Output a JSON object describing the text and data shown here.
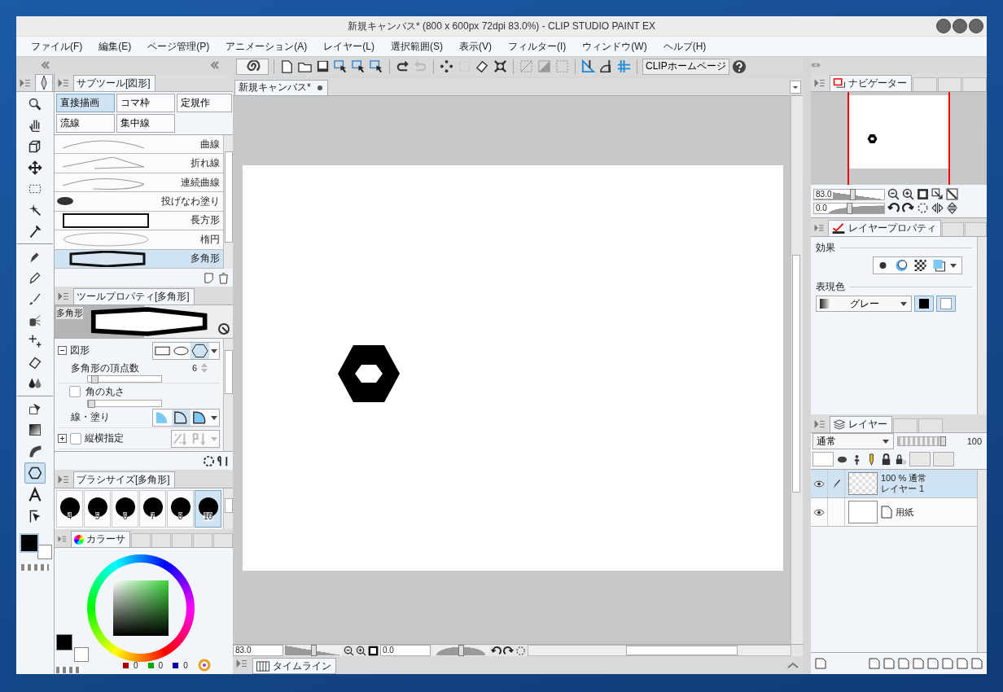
{
  "window": {
    "title": "新規キャンバス* (800 x 600px 72dpi 83.0%)  - CLIP STUDIO PAINT EX"
  },
  "menu": [
    {
      "label": "ファイル(F)"
    },
    {
      "label": "編集(E)"
    },
    {
      "label": "ページ管理(P)"
    },
    {
      "label": "アニメーション(A)"
    },
    {
      "label": "レイヤー(L)"
    },
    {
      "label": "選択範囲(S)"
    },
    {
      "label": "表示(V)"
    },
    {
      "label": "フィルター(I)"
    },
    {
      "label": "ウィンドウ(W)"
    },
    {
      "label": "ヘルプ(H)"
    }
  ],
  "toolbar": {
    "homepage": "CLIPホームページ"
  },
  "tools": [
    {
      "selected": false
    },
    {
      "selected": false
    },
    {
      "selected": false
    },
    {
      "selected": false
    },
    {
      "selected": false
    },
    {
      "selected": false
    },
    {
      "selected": false
    },
    {
      "selected": false
    },
    {
      "selected": false
    },
    {
      "selected": false
    },
    {
      "selected": false
    },
    {
      "selected": false
    },
    {
      "selected": false
    },
    {
      "selected": false
    },
    {
      "selected": false
    },
    {
      "selected": false
    },
    {
      "selected": false
    },
    {
      "selected": true
    },
    {
      "selected": false
    },
    {
      "selected": false
    }
  ],
  "subtool": {
    "tab": "サブツール[図形]",
    "groups": [
      {
        "label": "直接描画",
        "selected": true
      },
      {
        "label": "コマ枠",
        "selected": false
      },
      {
        "label": "定規作",
        "selected": false
      },
      {
        "label": "流線",
        "selected": false
      },
      {
        "label": "集中線",
        "selected": false
      }
    ],
    "items": [
      {
        "label": "曲線",
        "kind": "curve",
        "selected": false
      },
      {
        "label": "折れ線",
        "kind": "polyline",
        "selected": false
      },
      {
        "label": "連続曲線",
        "kind": "spline",
        "selected": false
      },
      {
        "label": "投げなわ塗り",
        "kind": "lasso",
        "selected": false
      },
      {
        "label": "長方形",
        "kind": "rect",
        "selected": false
      },
      {
        "label": "楕円",
        "kind": "ellipse",
        "selected": false
      },
      {
        "label": "多角形",
        "kind": "polygon",
        "selected": true
      }
    ]
  },
  "tool_property": {
    "tab": "ツールプロパティ[多角形]",
    "preview_label": "多角形",
    "shape_label": "図形",
    "expanded": true,
    "shapes": [
      {
        "selected": false
      },
      {
        "selected": false
      },
      {
        "selected": true
      }
    ],
    "vertex_label": "多角形の頂点数",
    "vertex_value": "6",
    "vertex_slider": {
      "level": 0.05
    },
    "corner": {
      "label": "角の丸さ",
      "checked": false,
      "level": 0
    },
    "line_fill_label": "線・塗り",
    "line_fill": [
      {
        "selected": false
      },
      {
        "selected": true
      },
      {
        "selected": false
      }
    ],
    "aspect": {
      "label": "縦横指定",
      "checked": false
    }
  },
  "brush_size": {
    "tab": "ブラシサイズ[多角形]",
    "sizes": [
      {
        "label": "4",
        "selected": false
      },
      {
        "label": "5",
        "selected": false
      },
      {
        "label": "6",
        "selected": false
      },
      {
        "label": "7",
        "selected": false
      },
      {
        "label": "8",
        "selected": false
      },
      {
        "label": "10",
        "selected": true
      }
    ]
  },
  "color": {
    "tab": "カラーサ",
    "values": [
      "0",
      "0",
      "0"
    ]
  },
  "canvas": {
    "tab": "新規キャンバス*",
    "zoom": "83.0",
    "zoom_slider": {
      "level": 0.5
    },
    "angle": "0.0",
    "rotation_slider": {
      "level": 0.5
    }
  },
  "timeline": {
    "tab": "タイムライン"
  },
  "navigator": {
    "tab": "ナビゲーター",
    "zoom": "83.0",
    "zoom_slider": {
      "level": 0.55
    },
    "angle": "0.0",
    "rotation_slider": {
      "level": 0.5
    }
  },
  "layer_property": {
    "tab": "レイヤープロパティ",
    "effect_label": "効果",
    "color_label": "表現色",
    "color_mode": "グレー"
  },
  "layers": {
    "tab": "レイヤー",
    "blend": "通常",
    "opacity": "100",
    "opacity_slider": {
      "level": 1
    },
    "items": [
      {
        "info": "100 % 通常",
        "name": "レイヤー 1",
        "kind": "raster",
        "selected": true,
        "visible": true
      },
      {
        "name": "用紙",
        "kind": "paper",
        "selected": false,
        "visible": true
      }
    ]
  }
}
